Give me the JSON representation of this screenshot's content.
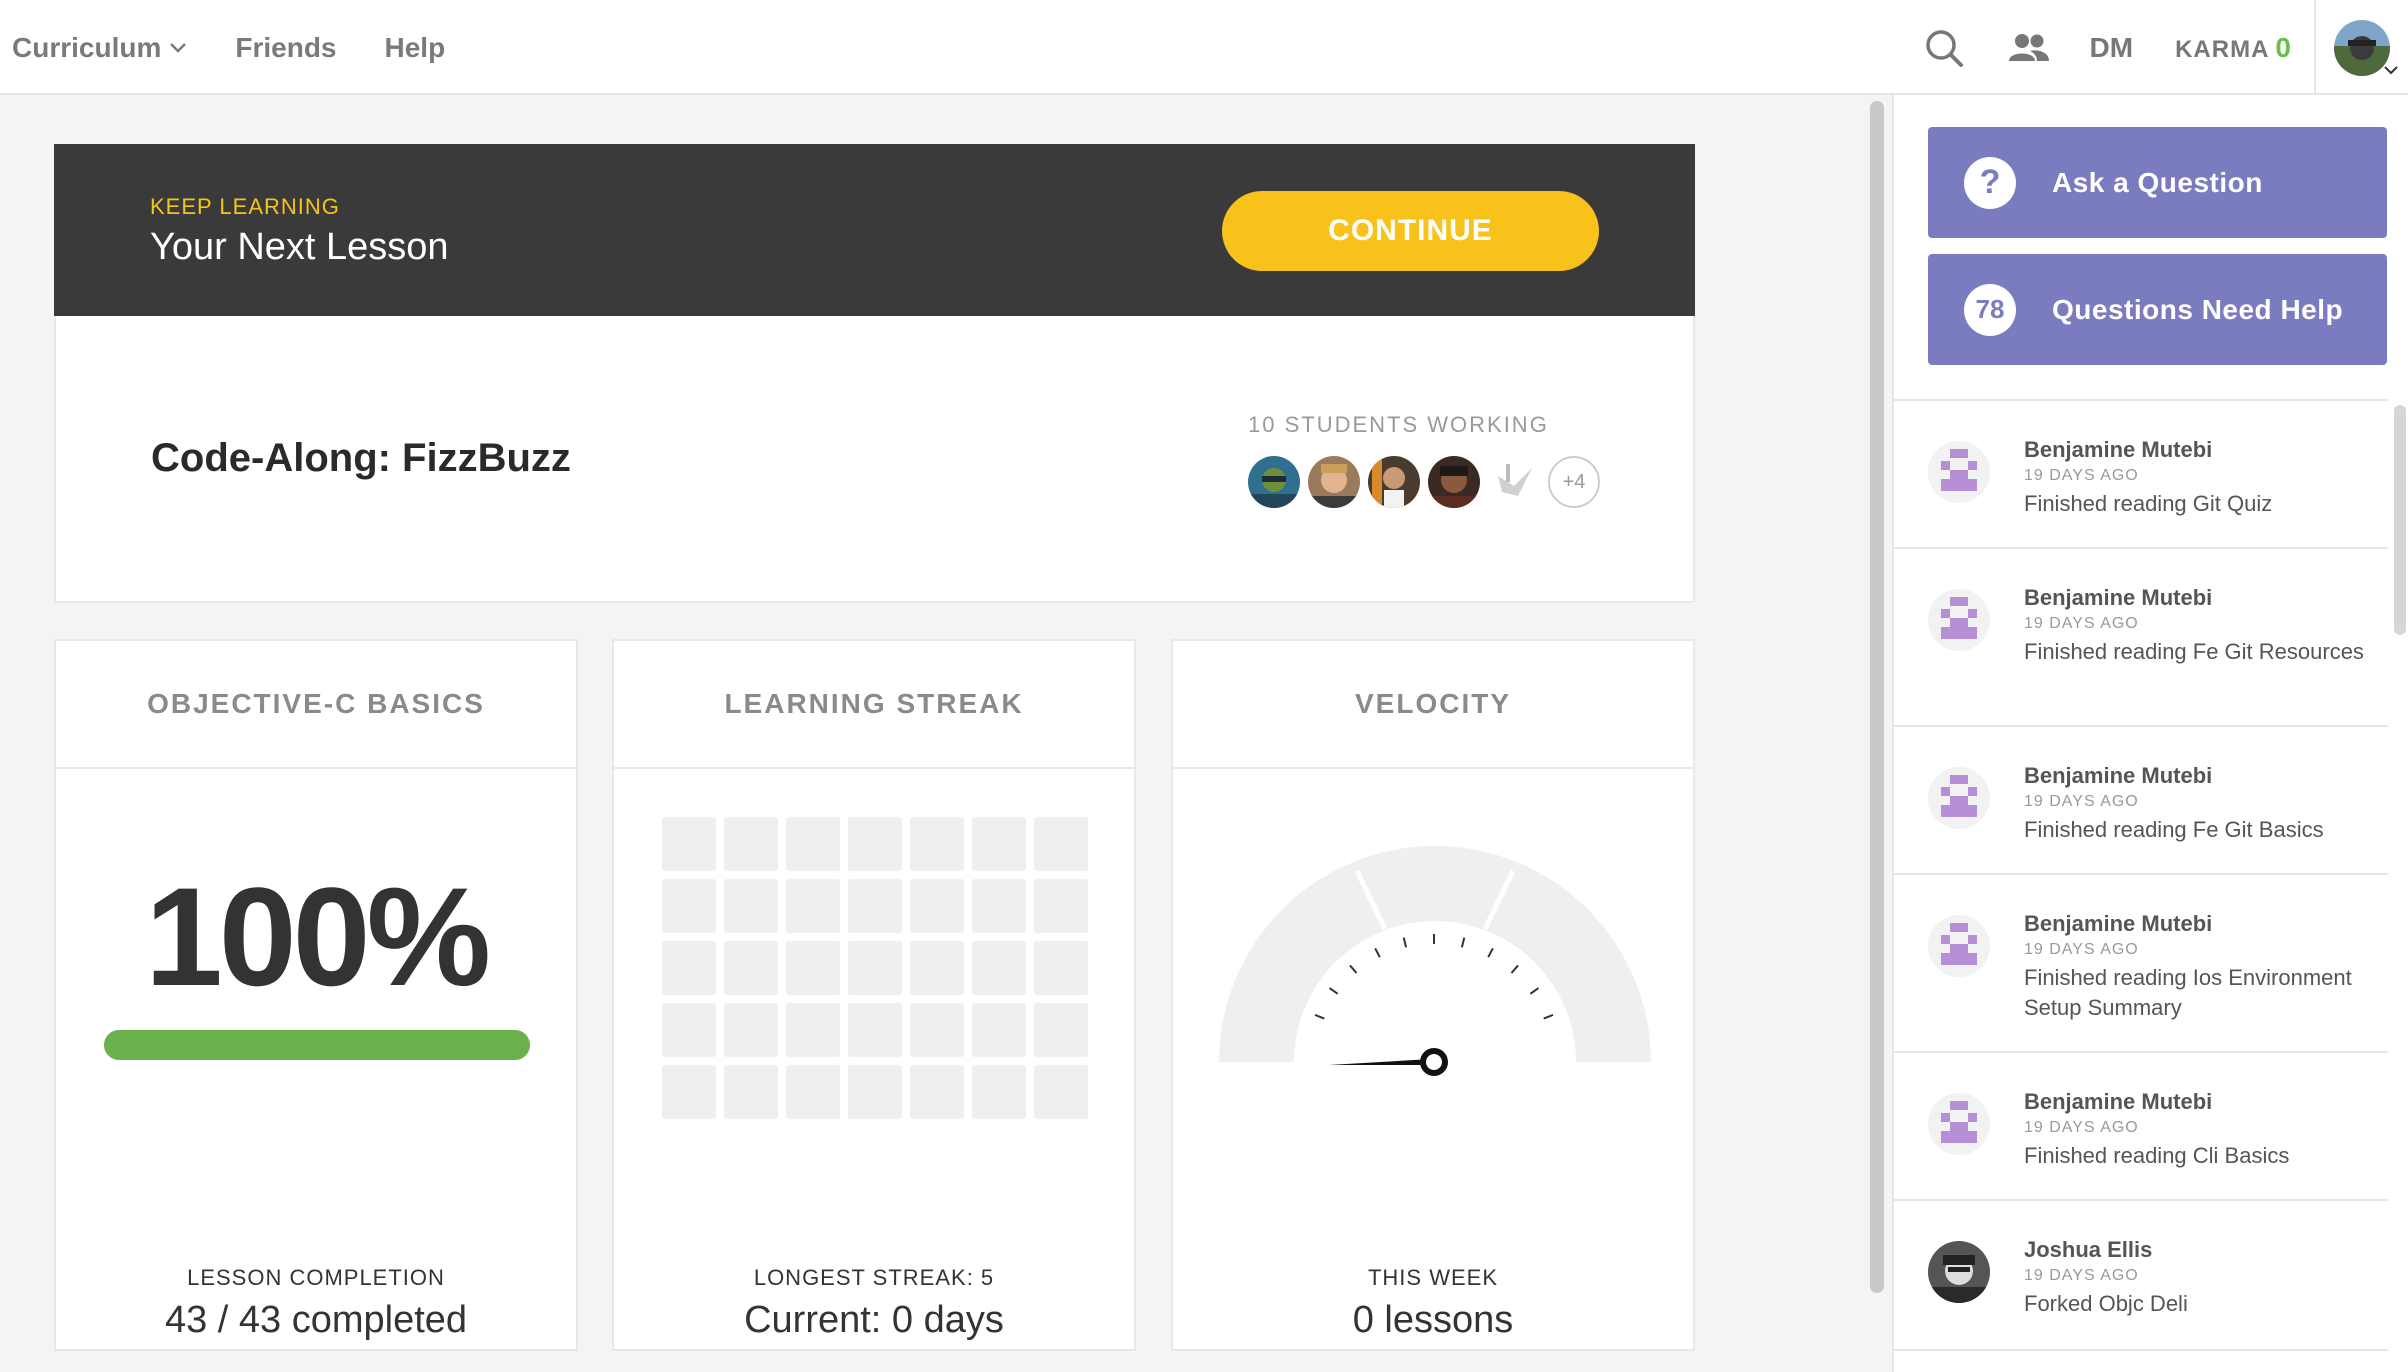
{
  "nav": {
    "curriculum": "Curriculum",
    "friends": "Friends",
    "help": "Help",
    "dm": "DM",
    "karma_label": "KARMA",
    "karma_value": "0",
    "icons": [
      "search-icon",
      "friends-icon",
      "chevron-down-icon"
    ]
  },
  "hero": {
    "eyebrow": "KEEP LEARNING",
    "title": "Your Next Lesson",
    "continue_label": "CONTINUE"
  },
  "lesson": {
    "title": "Code-Along: FizzBuzz",
    "students_label": "10 STUDENTS WORKING",
    "more_count": "+4"
  },
  "stats": {
    "completion": {
      "header": "OBJECTIVE-C BASICS",
      "percent_text": "100%",
      "progress_fraction": 1.0,
      "caption": "LESSON COMPLETION",
      "value": "43 / 43 completed"
    },
    "streak": {
      "header": "LEARNING STREAK",
      "caption": "LONGEST STREAK: 5",
      "value": "Current: 0 days"
    },
    "velocity": {
      "header": "VELOCITY",
      "caption": "THIS WEEK",
      "value": "0 lessons",
      "gauge_level": 0
    }
  },
  "sidebar": {
    "ask_label": "Ask a Question",
    "ask_icon": "?",
    "need_help_label": "Questions Need Help",
    "need_help_count": "78",
    "feed": [
      {
        "name": "Benjamine Mutebi",
        "time": "19 DAYS AGO",
        "text": "Finished reading Git Quiz"
      },
      {
        "name": "Benjamine Mutebi",
        "time": "19 DAYS AGO",
        "text": "Finished reading Fe Git Resources"
      },
      {
        "name": "Benjamine Mutebi",
        "time": "19 DAYS AGO",
        "text": "Finished reading Fe Git Basics"
      },
      {
        "name": "Benjamine Mutebi",
        "time": "19 DAYS AGO",
        "text": "Finished reading Ios Environment Setup Summary"
      },
      {
        "name": "Benjamine Mutebi",
        "time": "19 DAYS AGO",
        "text": "Finished reading Cli Basics"
      },
      {
        "name": "Joshua Ellis",
        "time": "19 DAYS AGO",
        "text": "Forked Objc Deli"
      }
    ]
  },
  "colors": {
    "accent_yellow": "#f9c21b",
    "progress_green": "#6ab04c",
    "karma_green": "#6abd45",
    "sidebar_purple": "#7b7cbf",
    "hero_dark": "#3a3a3a"
  }
}
